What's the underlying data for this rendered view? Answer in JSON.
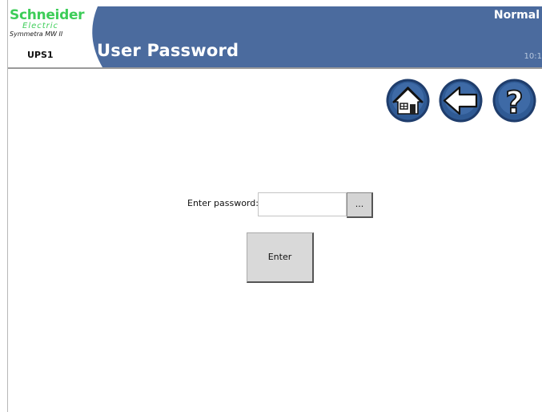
{
  "header": {
    "brand_name": "Schneider",
    "brand_sub": "Electric",
    "product": "Symmetra MW II",
    "device": "UPS1",
    "title": "User Password",
    "status": "Normal",
    "clock": "10:1"
  },
  "nav": {
    "home_icon": "home-icon",
    "back_icon": "back-arrow-icon",
    "help_icon": "help-icon"
  },
  "form": {
    "password_label": "Enter password:",
    "password_value": "",
    "browse_label": "...",
    "enter_label": "Enter"
  },
  "colors": {
    "header_bg": "#4b6b9e",
    "brand_green": "#3dcd58",
    "icon_blue": "#2a4f86"
  }
}
